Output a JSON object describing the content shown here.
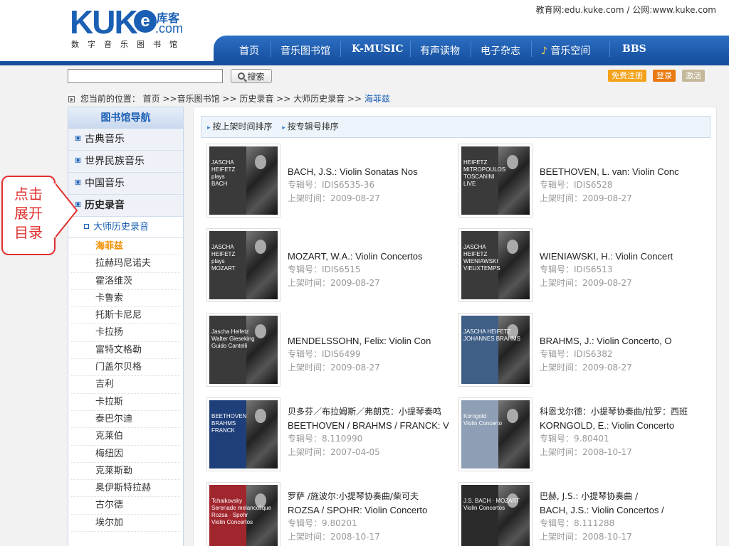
{
  "header": {
    "logo_text": "KUKE",
    "logo_cn": "库客",
    "logo_domain": ".com",
    "logo_sub": "数字音乐图书馆",
    "top_links": "教育网:edu.kuke.com / 公网:www.kuke.com"
  },
  "nav": {
    "items": [
      "首页",
      "音乐图书馆",
      "K-MUSIC",
      "有声读物",
      "电子杂志",
      "音乐空间",
      "BBS"
    ]
  },
  "search": {
    "placeholder": "",
    "button_label": "搜索",
    "register": "免费注册",
    "login": "登录",
    "activate": "激活"
  },
  "breadcrumb": {
    "prefix": "您当前的位置：",
    "path": "首页 >>音乐图书馆 >> 历史录音 >> 大师历史录音 >> ",
    "current": "海菲兹"
  },
  "sidebar": {
    "title": "图书馆导航",
    "categories": [
      "古典音乐",
      "世界民族音乐",
      "中国音乐",
      "历史录音"
    ],
    "subcategory": "大师历史录音",
    "items": [
      "海菲兹",
      "拉赫玛尼诺夫",
      "霍洛维茨",
      "卡鲁索",
      "托斯卡尼尼",
      "卡拉扬",
      "富特文格勒",
      "门盖尔贝格",
      "吉利",
      "卡拉斯",
      "泰巴尔迪",
      "克莱伯",
      "梅纽因",
      "克莱斯勒",
      "奥伊斯特拉赫",
      "古尔德",
      "埃尔加"
    ]
  },
  "callout": {
    "text": "点击展开目录",
    "line1": "点击",
    "line2": "展开",
    "line3": "目录"
  },
  "sort": {
    "by_date": "按上架时间排序",
    "by_number": "按专辑号排序"
  },
  "albums": [
    {
      "cn": "",
      "title": "BACH, J.S.: Violin Sonatas Nos",
      "number": "专辑号：IDIS6535-36",
      "date": "上架时间：2009-08-27",
      "cover_lines": [
        "JASCHA",
        "HEIFETZ",
        "plays",
        "BACH"
      ],
      "cover_color": "#3a3a3a"
    },
    {
      "cn": "",
      "title": "BEETHOVEN, L. van: Violin Conc",
      "number": "专辑号：IDIS6528",
      "date": "上架时间：2009-08-27",
      "cover_lines": [
        "HEIFETZ",
        "MITROPOULOS",
        "TOSCANINI",
        "LIVE"
      ],
      "cover_color": "#3a3a3a"
    },
    {
      "cn": "",
      "title": "MOZART, W.A.: Violin Concertos",
      "number": "专辑号：IDIS6515",
      "date": "上架时间：2009-08-27",
      "cover_lines": [
        "JASCHA",
        "HEIFETZ",
        "plays",
        "MOZART"
      ],
      "cover_color": "#3a3a3a"
    },
    {
      "cn": "",
      "title": "WIENIAWSKI, H.: Violin Concert",
      "number": "专辑号：IDIS6513",
      "date": "上架时间：2009-08-27",
      "cover_lines": [
        "JASCHA",
        "HEIFETZ",
        "WIENIAWSKI",
        "VIEUXTEMPS"
      ],
      "cover_color": "#3a3a3a"
    },
    {
      "cn": "",
      "title": "MENDELSSOHN, Felix: Violin Con",
      "number": "专辑号：IDIS6499",
      "date": "上架时间：2009-08-27",
      "cover_lines": [
        "Jascha Heifetz",
        "Walter Gieseking",
        "Guido Cantelli",
        ""
      ],
      "cover_color": "#3a3a3a"
    },
    {
      "cn": "",
      "title": "BRAHMS, J.: Violin Concerto, O",
      "number": "专辑号：IDIS6382",
      "date": "上架时间：2009-08-27",
      "cover_lines": [
        "JASCHA HEIFETZ",
        "JOHANNES BRAHMS",
        "",
        ""
      ],
      "cover_color": "#3f5f86"
    },
    {
      "cn": "贝多芬／布拉姆斯／弗朗克：小提琴奏鸣",
      "title": "BEETHOVEN / BRAHMS / FRANCK: V",
      "number": "专辑号：8.110990",
      "date": "上架时间：2007-04-05",
      "cover_lines": [
        "BEETHOVEN",
        "BRAHMS",
        "FRANCK",
        ""
      ],
      "cover_color": "#1e3f7a"
    },
    {
      "cn": "科恩戈尔德：小提琴协奏曲/拉罗：西班",
      "title": "KORNGOLD, E.: Violin Concerto",
      "number": "专辑号：9.80401",
      "date": "上架时间：2008-10-17",
      "cover_lines": [
        "Korngold",
        "Violin Concerto",
        "",
        ""
      ],
      "cover_color": "#8e9fb5"
    },
    {
      "cn": "罗萨 /施波尔:小提琴协奏曲/柴可夫",
      "title": "ROZSA / SPOHR: Violin Concerto",
      "number": "专辑号：9.80201",
      "date": "上架时间：2008-10-17",
      "cover_lines": [
        "Tchaikovsky",
        "Serenade melancolique",
        "Rozsa · Spohr",
        "Violin Concertos"
      ],
      "cover_color": "#a0262e"
    },
    {
      "cn": "巴赫, J.S.: 小提琴协奏曲 /",
      "title": "BACH, J.S.: Violin Concertos /",
      "number": "专辑号：8.111288",
      "date": "上架时间：2008-10-17",
      "cover_lines": [
        "J.S. BACH · MOZART",
        "Violin Concertos",
        "",
        ""
      ],
      "cover_color": "#2b2b2b"
    }
  ],
  "colors": {
    "brand_blue": "#1a5fb4",
    "nav_blue": "#164f9d",
    "highlight_orange": "#f09000",
    "callout_red": "#e03030",
    "register_btn": "#f4a21a",
    "login_btn": "#e87a10",
    "activate_btn": "#c5b89a"
  }
}
